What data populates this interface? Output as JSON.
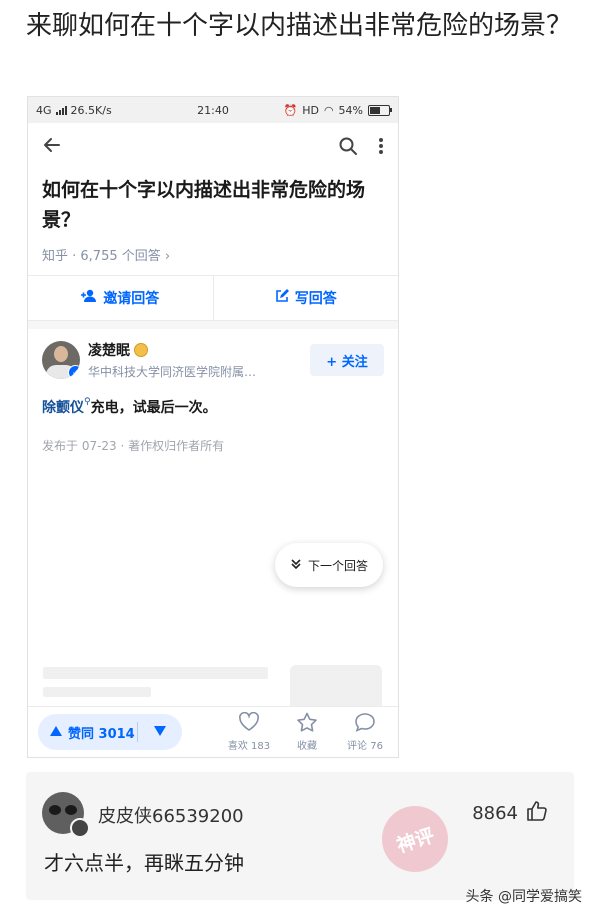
{
  "post": {
    "title": "来聊如何在十个字以内描述出非常危险的场景？"
  },
  "phone": {
    "status_bar": {
      "network": "4G",
      "speed": "26.5K/s",
      "time": "21:40",
      "hd": "HD",
      "battery": "54%",
      "battery_level": 0.54
    },
    "nav": {
      "back_icon": "back-arrow-icon",
      "search_icon": "search-icon",
      "more_icon": "more-vertical-icon"
    },
    "question": {
      "title": "如何在十个字以内描述出非常危险的场景？",
      "meta": "知乎 · 6,755 个回答 ›"
    },
    "actions": {
      "invite": "邀请回答",
      "write": "写回答"
    },
    "answer": {
      "author": "凌楚眠",
      "bio": "华中科技大学同济医学院附属…",
      "follow": "+ 关注",
      "keyword": "除颤仪",
      "content": "充电，试最后一次。",
      "published": "发布于 07-23 · 著作权归作者所有"
    },
    "next_answer": "下一个回答",
    "bottom": {
      "vote": "赞同 3014",
      "like": "喜欢 183",
      "collect": "收藏",
      "comment": "评论 76"
    }
  },
  "comment": {
    "username": "皮皮侠66539200",
    "likes": "8864",
    "text": "才六点半，再眯五分钟",
    "stamp": "神评"
  },
  "watermark": "头条 @同学爱搞笑",
  "colors": {
    "accent": "#0066ff",
    "link": "#175199",
    "meta": "#8590a6"
  }
}
